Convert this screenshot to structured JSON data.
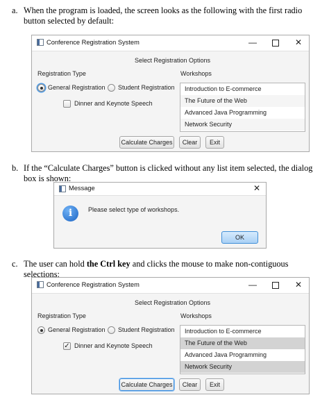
{
  "paragraphs": {
    "a": {
      "label": "a.",
      "text": "When the program is loaded, the screen looks as the following with the first radio button selected by default:"
    },
    "b": {
      "label": "b.",
      "text": "If the “Calculate Charges” button is clicked without any list item selected, the dialog box is shown:"
    },
    "c": {
      "label": "c.",
      "text_before": "The user can hold ",
      "text_bold": "the Ctrl key",
      "text_after": " and clicks the mouse to make non-contiguous selections:"
    }
  },
  "window1": {
    "title": "Conference Registration System",
    "header": "Select Registration Options",
    "reg_type_label": "Registration Type",
    "workshops_label": "Workshops",
    "radio_general": "General Registration",
    "radio_student": "Student Registration",
    "general_selected": true,
    "dinner_label": "Dinner and Keynote Speech",
    "dinner_checked": false,
    "workshops": [
      {
        "label": "Introduction to E-commerce",
        "selected": false
      },
      {
        "label": "The Future of the Web",
        "selected": false
      },
      {
        "label": "Advanced Java Programming",
        "selected": false
      },
      {
        "label": "Network Security",
        "selected": false
      }
    ],
    "calc_button": "Calculate Charges",
    "clear_button": "Clear",
    "exit_button": "Exit"
  },
  "dialog": {
    "title": "Message",
    "message": "Please select type of workshops.",
    "ok_button": "OK",
    "icon": "info-icon"
  },
  "window2": {
    "title": "Conference Registration System",
    "header": "Select Registration Options",
    "reg_type_label": "Registration Type",
    "workshops_label": "Workshops",
    "radio_general": "General Registration",
    "radio_student": "Student Registration",
    "general_selected": true,
    "dinner_label": "Dinner and Keynote Speech",
    "dinner_checked": true,
    "check_mark": "✓",
    "workshops": [
      {
        "label": "Introduction to E-commerce",
        "selected": false
      },
      {
        "label": "The Future of the Web",
        "selected": true
      },
      {
        "label": "Advanced Java Programming",
        "selected": false
      },
      {
        "label": "Network Security",
        "selected": true
      }
    ],
    "calc_button": "Calculate Charges",
    "clear_button": "Clear",
    "exit_button": "Exit"
  },
  "window_controls": {
    "minimize": "—",
    "close": "✕"
  }
}
